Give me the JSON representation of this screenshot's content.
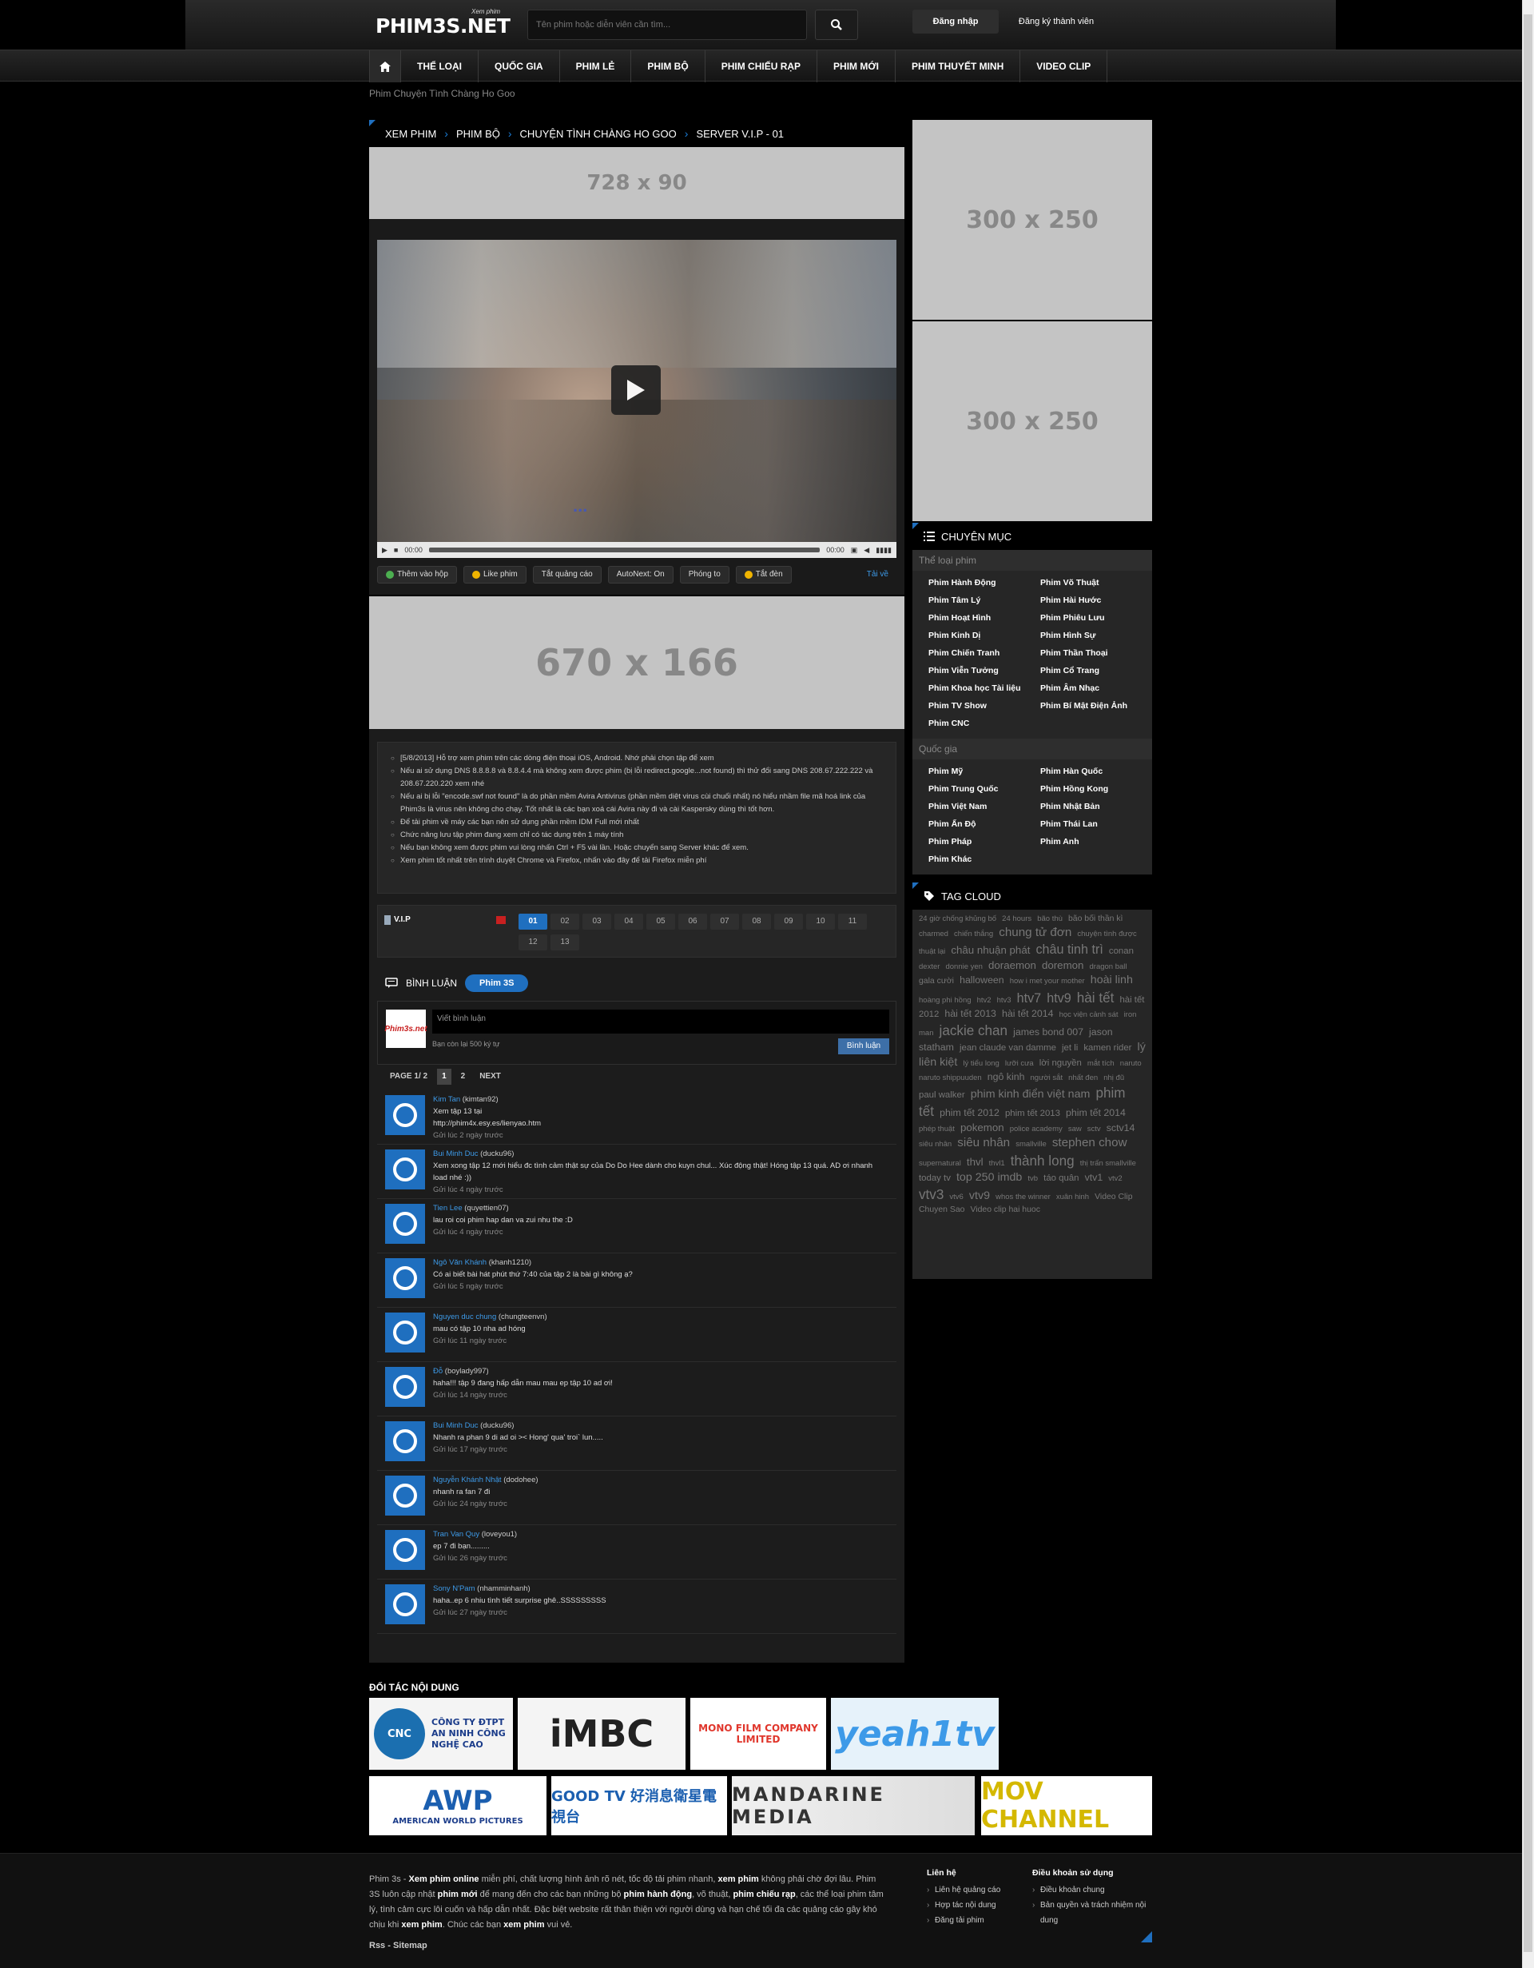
{
  "header": {
    "logo_text": "PHIM3S.NET",
    "logo_tagline": "Xem phim",
    "search_placeholder": "Tên phim hoặc diễn viên cần tìm...",
    "login_label": "Đăng nhập",
    "register_label": "Đăng ký thành viên"
  },
  "nav": {
    "items": [
      "THỂ LOẠI",
      "QUỐC GIA",
      "PHIM LẺ",
      "PHIM BỘ",
      "PHIM CHIẾU RẠP",
      "PHIM MỚI",
      "PHIM THUYẾT MINH",
      "VIDEO CLIP"
    ]
  },
  "page_subtitle": "Phim Chuyện Tình Chàng Ho Goo",
  "breadcrumb": [
    "XEM PHIM",
    "PHIM BỘ",
    "CHUYỆN TÌNH CHÀNG HO GOO",
    "SERVER V.I.P - 01"
  ],
  "ads": {
    "top": "728 x 90",
    "below_player": "670 x 166",
    "side1": "300 x 250",
    "side2": "300 x 250"
  },
  "player": {
    "time_current": "00:00",
    "time_total": "00:00",
    "caption": "...",
    "tools": [
      "Thêm vào hộp",
      "Like phim",
      "Tắt quảng cáo",
      "AutoNext: On",
      "Phóng to",
      "Tắt đèn",
      "Tải về"
    ]
  },
  "notes": [
    "[5/8/2013] Hỗ trợ xem phim trên các dòng điện thoại iOS, Android. Nhớ phải chọn tập để xem",
    "Nếu ai sử dụng DNS 8.8.8.8 và 8.8.4.4 mà không xem được phim (bị lỗi redirect.google...not found) thì thử đổi sang DNS 208.67.222.222 và 208.67.220.220 xem nhé",
    "Nếu ai bị lỗi \"encode.swf not found\" là do phần mềm Avira Antivirus (phần mềm diệt virus cùi chuối nhất) nó hiểu nhầm file mã hoá link của Phim3s là virus nên không cho chạy. Tốt nhất là các bạn xoá cái Avira này đi và cài Kaspersky dùng thì tốt hơn.",
    "Để tải phim về máy các bạn nên sử dụng phần mềm IDM Full mới nhất",
    "Chức năng lưu tập phim đang xem chỉ có tác dụng trên 1 máy tính",
    "Nếu bạn không xem được phim vui lòng nhấn Ctrl + F5 vài lần. Hoặc chuyển sang Server khác để xem.",
    "Xem phim tốt nhất trên trình duyệt Chrome và Firefox, nhấn vào đây để tải Firefox miễn phí"
  ],
  "episodes": {
    "server_label": "V.I.P",
    "list": [
      "01",
      "02",
      "03",
      "04",
      "05",
      "06",
      "07",
      "08",
      "09",
      "10",
      "11",
      "12",
      "13"
    ],
    "active": "01"
  },
  "comments_section": {
    "title": "BÌNH LUẬN",
    "tab": "Phim 3S",
    "input_placeholder": "Viết bình luận",
    "char_count": "Bạn còn lại 500 ký tự",
    "submit_label": "Bình luận",
    "avatar_text": "Phim3s.net",
    "page_label": "PAGE 1/ 2",
    "pages": [
      "1",
      "2"
    ],
    "next_label": "NEXT"
  },
  "comments": [
    {
      "name": "Kim Tan",
      "user": "(kimtan92)",
      "text": "Xem tập 13 tại\nhttp://phim4x.esy.es/lienyao.htm",
      "time": "Gửi lúc 2 ngày trước"
    },
    {
      "name": "Bui Minh Duc",
      "user": "(ducku96)",
      "text": "Xem xong tập 12 mới hiểu đc tình cảm thật sự của Do Do Hee dành cho kuyn chul... Xúc động thật! Hóng tập 13 quá. AD ơi nhanh load nhé :))",
      "time": "Gửi lúc 4 ngày trước"
    },
    {
      "name": "Tien Lee",
      "user": "(quyettien07)",
      "text": "lau roi coi phim hap dan va zui nhu the :D",
      "time": "Gửi lúc 4 ngày trước"
    },
    {
      "name": "Ngô Văn Khánh",
      "user": "(khanh1210)",
      "text": "Có ai biết bài hát phút thứ 7:40 của tập 2 là bài gì không ạ?",
      "time": "Gửi lúc 5 ngày trước"
    },
    {
      "name": "Nguyen duc chung",
      "user": "(chungteenvn)",
      "text": "mau có tập 10 nha ad hóng",
      "time": "Gửi lúc 11 ngày trước"
    },
    {
      "name": "Đỗ",
      "user": "(boylady997)",
      "text": "haha!!! tập 9 đang hấp dẫn mau mau ep tập 10 ad ơi!",
      "time": "Gửi lúc 14 ngày trước"
    },
    {
      "name": "Bui Minh Duc",
      "user": "(ducku96)",
      "text": "Nhanh ra phan 9 di ad oi >< Hong' qua' troi` lun.....",
      "time": "Gửi lúc 17 ngày trước"
    },
    {
      "name": "Nguyễn Khánh Nhật",
      "user": "(dodohee)",
      "text": "nhanh ra fan 7 đi",
      "time": "Gửi lúc 24 ngày trước"
    },
    {
      "name": "Tran Van Quy",
      "user": "(loveyou1)",
      "text": "ep 7 đi bạn.........",
      "time": "Gửi lúc 26 ngày trước"
    },
    {
      "name": "Sony N'Pam",
      "user": "(nhamminhanh)",
      "text": "haha..ep 6 nhiu tình tiết surprise ghê..SSSSSSSSS",
      "time": "Gửi lúc 27 ngày trước"
    }
  ],
  "sidebar": {
    "category_title": "CHUYÊN MỤC",
    "genre_label": "Thể loại phim",
    "genres": [
      "Phim Hành Động",
      "Phim Võ Thuật",
      "Phim Tâm Lý",
      "Phim Hài Hước",
      "Phim Hoạt Hình",
      "Phim Phiêu Lưu",
      "Phim Kinh Dị",
      "Phim Hình Sự",
      "Phim Chiến Tranh",
      "Phim Thần Thoại",
      "Phim Viễn Tưởng",
      "Phim Cổ Trang",
      "Phim Khoa học Tài liệu",
      "Phim Âm Nhạc",
      "Phim TV Show",
      "Phim Bí Mật Điện Ảnh",
      "Phim CNC"
    ],
    "country_label": "Quốc gia",
    "countries": [
      "Phim Mỹ",
      "Phim Hàn Quốc",
      "Phim Trung Quốc",
      "Phim Hồng Kong",
      "Phim Việt Nam",
      "Phim Nhật Bản",
      "Phim Ấn Độ",
      "Phim Thái Lan",
      "Phim Pháp",
      "Phim Anh",
      "Phim Khác"
    ],
    "tag_title": "TAG CLOUD",
    "tags": [
      {
        "t": "24 giờ chống khủng bố",
        "s": 10
      },
      {
        "t": "24 hours",
        "s": 10
      },
      {
        "t": "bão thù",
        "s": 10
      },
      {
        "t": "bão bối thần kì",
        "s": 11
      },
      {
        "t": "charmed",
        "s": 10
      },
      {
        "t": "chiến thắng",
        "s": 10
      },
      {
        "t": "chung tử đơn",
        "s": 16
      },
      {
        "t": "chuyện tình được thuật lại",
        "s": 10
      },
      {
        "t": "châu nhuận phát",
        "s": 14
      },
      {
        "t": "châu tinh trì",
        "s": 17
      },
      {
        "t": "conan",
        "s": 12
      },
      {
        "t": "dexter",
        "s": 10
      },
      {
        "t": "donnie yen",
        "s": 10
      },
      {
        "t": "doraemon",
        "s": 14
      },
      {
        "t": "doremon",
        "s": 14
      },
      {
        "t": "dragon ball",
        "s": 10
      },
      {
        "t": "gala cười",
        "s": 11
      },
      {
        "t": "halloween",
        "s": 13
      },
      {
        "t": "how i met your mother",
        "s": 10
      },
      {
        "t": "hoài linh",
        "s": 15
      },
      {
        "t": "hoàng phi hồng",
        "s": 10
      },
      {
        "t": "htv2",
        "s": 10
      },
      {
        "t": "htv3",
        "s": 10
      },
      {
        "t": "htv7",
        "s": 17
      },
      {
        "t": "htv9",
        "s": 17
      },
      {
        "t": "hài tết",
        "s": 18
      },
      {
        "t": "hài tết 2012",
        "s": 12
      },
      {
        "t": "hài tết 2013",
        "s": 13
      },
      {
        "t": "hài tết 2014",
        "s": 13
      },
      {
        "t": "học viện cảnh sát",
        "s": 10
      },
      {
        "t": "iron man",
        "s": 10
      },
      {
        "t": "jackie chan",
        "s": 18
      },
      {
        "t": "james bond 007",
        "s": 13
      },
      {
        "t": "jason statham",
        "s": 13
      },
      {
        "t": "jean claude van damme",
        "s": 12
      },
      {
        "t": "jet li",
        "s": 12
      },
      {
        "t": "kamen rider",
        "s": 12
      },
      {
        "t": "lý liên kiệt",
        "s": 15
      },
      {
        "t": "lý tiểu long",
        "s": 10
      },
      {
        "t": "lưỡi cưa",
        "s": 10
      },
      {
        "t": "lời nguyền",
        "s": 12
      },
      {
        "t": "mắt tích",
        "s": 10
      },
      {
        "t": "naruto",
        "s": 10
      },
      {
        "t": "naruto shippuuden",
        "s": 10
      },
      {
        "t": "ngô kinh",
        "s": 13
      },
      {
        "t": "người sắt",
        "s": 10
      },
      {
        "t": "nhất đen",
        "s": 10
      },
      {
        "t": "nhị đũ",
        "s": 10
      },
      {
        "t": "paul walker",
        "s": 12
      },
      {
        "t": "phim kinh điển việt nam",
        "s": 15
      },
      {
        "t": "phim tết",
        "s": 18
      },
      {
        "t": "phim tết 2012",
        "s": 13
      },
      {
        "t": "phim tết 2013",
        "s": 12
      },
      {
        "t": "phim tết 2014",
        "s": 13
      },
      {
        "t": "phép thuật",
        "s": 10
      },
      {
        "t": "pokemon",
        "s": 14
      },
      {
        "t": "police academy",
        "s": 10
      },
      {
        "t": "saw",
        "s": 10
      },
      {
        "t": "sctv",
        "s": 10
      },
      {
        "t": "sctv14",
        "s": 13
      },
      {
        "t": "siêu nhân",
        "s": 10
      },
      {
        "t": "siêu nhân",
        "s": 16
      },
      {
        "t": "smallville",
        "s": 10
      },
      {
        "t": "stephen chow",
        "s": 16
      },
      {
        "t": "supernatural",
        "s": 10
      },
      {
        "t": "thvl",
        "s": 14
      },
      {
        "t": "thvl1",
        "s": 10
      },
      {
        "t": "thành long",
        "s": 18
      },
      {
        "t": "thị trấn smallville",
        "s": 10
      },
      {
        "t": "today tv",
        "s": 12
      },
      {
        "t": "top 250 imdb",
        "s": 15
      },
      {
        "t": "tvb",
        "s": 10
      },
      {
        "t": "táo quân",
        "s": 12
      },
      {
        "t": "vtv1",
        "s": 13
      },
      {
        "t": "vtv2",
        "s": 10
      },
      {
        "t": "vtv3",
        "s": 18
      },
      {
        "t": "vtv6",
        "s": 10
      },
      {
        "t": "vtv9",
        "s": 15
      },
      {
        "t": "whos the winner",
        "s": 10
      },
      {
        "t": "xuân hinh",
        "s": 10
      },
      {
        "t": "Video Clip",
        "s": 11
      },
      {
        "t": "Chuyen Sao",
        "s": 11
      },
      {
        "t": "Video clip hai huoc",
        "s": 11
      }
    ]
  },
  "partners": {
    "title": "ĐỐI TÁC NỘI DUNG",
    "logos": [
      "CÔNG TY ĐTPT AN NINH CÔNG NGHỆ CAO",
      "iMBC",
      "MONO FILM COMPANY LIMITED",
      "yeah1tv",
      "AMERICAN WORLD PICTURES",
      "GOOD TV 好消息衛星電視台",
      "MANDARINE MEDIA",
      "MOV CHANNEL"
    ],
    "cnc_short": "CNC",
    "awp_short": "AWP"
  },
  "footer": {
    "rss": "Rss - Sitemap",
    "col1_title": "Liên hệ",
    "col1": [
      "Liên hệ quảng cáo",
      "Hợp tác nội dung",
      "Đăng tải phim"
    ],
    "col2_title": "Điều khoản sử dụng",
    "col2": [
      "Điều khoản chung",
      "Bản quyền và trách nhiệm nội dung"
    ]
  },
  "colors": {
    "accent": "#1f6fbf",
    "link": "#3d9ae8",
    "bg": "#000000",
    "panel": "#1c1c1c"
  }
}
